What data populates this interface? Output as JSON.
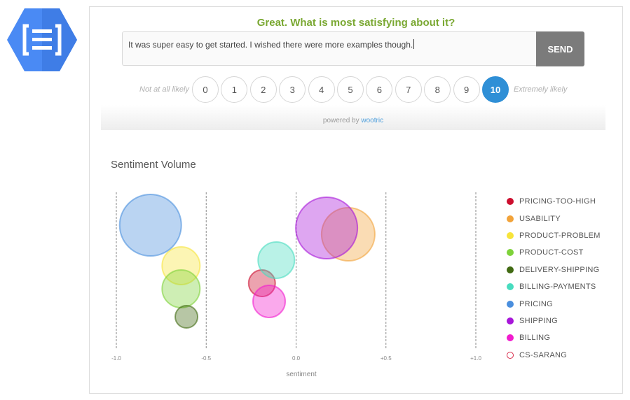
{
  "survey": {
    "question": "Great. What is most satisfying about it?",
    "answer": "It was super easy to get started. I wished there were more examples though.",
    "send_label": "SEND",
    "low_label": "Not at all likely",
    "high_label": "Extremely likely",
    "scores": [
      "0",
      "1",
      "2",
      "3",
      "4",
      "5",
      "6",
      "7",
      "8",
      "9",
      "10"
    ],
    "selected_score": "10",
    "powered_prefix": "powered by",
    "powered_brand": "wootric"
  },
  "colors": {
    "question": "#7aa832",
    "selected": "#2f8fd6",
    "logo": "#4a8af4"
  },
  "logo_icon": "document-brackets-icon",
  "chart_data": {
    "type": "scatter",
    "title": "Sentiment Volume",
    "xlabel": "sentiment",
    "ylabel": "",
    "xlim": [
      -1.0,
      1.0
    ],
    "xticks": [
      "-1.0",
      "-0.5",
      "0.0",
      "+0.5",
      "+1.0"
    ],
    "grid": true,
    "legend_position": "right",
    "series": [
      {
        "name": "PRICING-TOO-HIGH",
        "color": "#cc0e2e",
        "hollow": false,
        "x": -0.19,
        "size": 19
      },
      {
        "name": "USABILITY",
        "color": "#f2a33a",
        "hollow": false,
        "x": 0.29,
        "size": 38
      },
      {
        "name": "PRODUCT-PROBLEM",
        "color": "#f7e43a",
        "hollow": false,
        "x": -0.64,
        "size": 27
      },
      {
        "name": "PRODUCT-COST",
        "color": "#7ed23a",
        "hollow": false,
        "x": -0.64,
        "size": 27
      },
      {
        "name": "DELIVERY-SHIPPING",
        "color": "#416a13",
        "hollow": false,
        "x": -0.61,
        "size": 16
      },
      {
        "name": "BILLING-PAYMENTS",
        "color": "#48dcbf",
        "hollow": false,
        "x": -0.11,
        "size": 26
      },
      {
        "name": "PRICING",
        "color": "#4a8fde",
        "hollow": false,
        "x": -0.81,
        "size": 44
      },
      {
        "name": "SHIPPING",
        "color": "#a716d9",
        "hollow": false,
        "x": 0.17,
        "size": 44
      },
      {
        "name": "BILLING",
        "color": "#f11cce",
        "hollow": false,
        "x": -0.15,
        "size": 23
      },
      {
        "name": "CS-SARANG",
        "color": "#d82a4a",
        "hollow": true,
        "x": null,
        "size": null
      }
    ]
  }
}
